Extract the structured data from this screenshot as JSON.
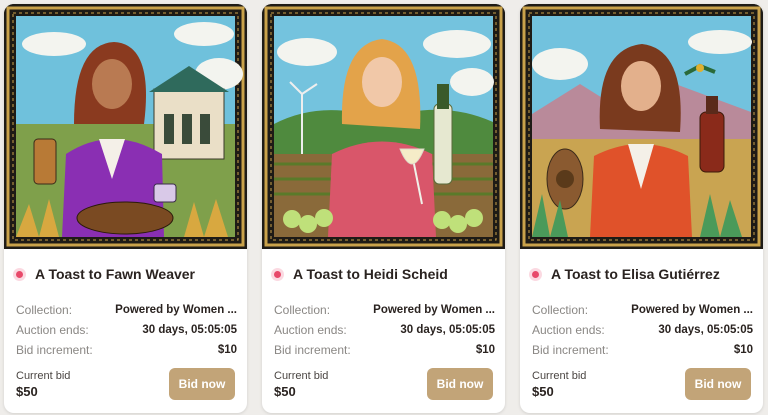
{
  "colors": {
    "accent_button": "#c2a478",
    "live_dot": "#e8496a",
    "page_bg": "#efedea"
  },
  "labels": {
    "collection": "Collection:",
    "auction_ends": "Auction ends:",
    "bid_increment": "Bid increment:",
    "current_bid": "Current bid",
    "bid_button": "Bid now"
  },
  "cards": [
    {
      "title": "A Toast to Fawn Weaver",
      "collection": "Powered by Women ...",
      "auction_ends": "30 days, 05:05:05",
      "bid_increment": "$10",
      "current_bid": "$50",
      "image": "illustration-woman-purple-jacket-whiskey-distillery"
    },
    {
      "title": "A Toast to Heidi Scheid",
      "collection": "Powered by Women ...",
      "auction_ends": "30 days, 05:05:05",
      "bid_increment": "$10",
      "current_bid": "$50",
      "image": "illustration-woman-wine-glass-vineyard"
    },
    {
      "title": "A Toast to Elisa Gutiérrez",
      "collection": "Powered by Women ...",
      "auction_ends": "30 days, 05:05:05",
      "bid_increment": "$10",
      "current_bid": "$50",
      "image": "illustration-woman-red-jacket-agave-field"
    }
  ]
}
